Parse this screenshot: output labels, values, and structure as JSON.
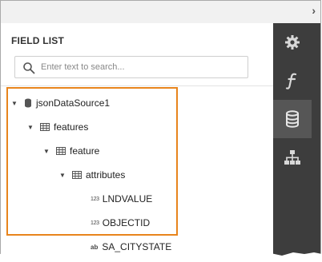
{
  "panel": {
    "title": "FIELD LIST",
    "search_placeholder": "Enter text to search..."
  },
  "tree": [
    {
      "label": "jsonDataSource1",
      "icon": "database-icon",
      "expanded": true
    },
    {
      "label": "features",
      "icon": "table-icon",
      "expanded": true
    },
    {
      "label": "feature",
      "icon": "table-icon",
      "expanded": true
    },
    {
      "label": "attributes",
      "icon": "table-icon",
      "expanded": true
    },
    {
      "label": "LNDVALUE",
      "icon": "number-type-icon",
      "type_glyph": "123"
    },
    {
      "label": "OBJECTID",
      "icon": "number-type-icon",
      "type_glyph": "123"
    },
    {
      "label": "SA_CITYSTATE",
      "icon": "string-type-icon",
      "type_glyph": "ab"
    }
  ],
  "sidebar": {
    "buttons": [
      {
        "name": "settings",
        "icon": "gear-icon"
      },
      {
        "name": "functions",
        "icon": "function-icon"
      },
      {
        "name": "field-list",
        "icon": "database-icon",
        "active": true
      },
      {
        "name": "report-explorer",
        "icon": "hierarchy-icon"
      }
    ]
  },
  "colors": {
    "highlight": "#e8841c",
    "sidebar_bg": "#3d3d3d",
    "sidebar_active": "#565656"
  }
}
